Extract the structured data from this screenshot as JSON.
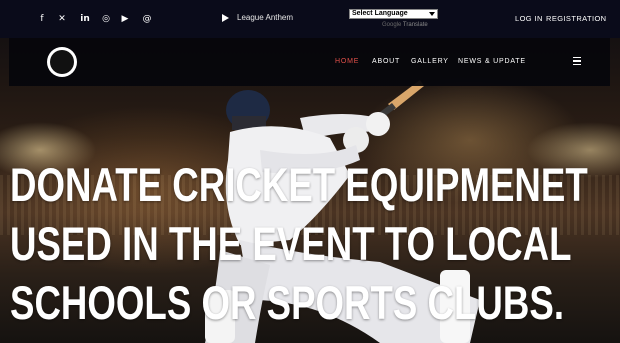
{
  "topbar": {
    "social": [
      {
        "name": "facebook-icon",
        "glyph": "f"
      },
      {
        "name": "x-icon",
        "glyph": "✕"
      },
      {
        "name": "linkedin-icon",
        "glyph": "in"
      },
      {
        "name": "instagram-icon",
        "glyph": "◎"
      },
      {
        "name": "youtube-icon",
        "glyph": "▶"
      },
      {
        "name": "threads-icon",
        "glyph": "@"
      }
    ],
    "anthem_label": "League Anthem",
    "language_select": "Select Language",
    "google_label": "Google",
    "translate_label": "Translate",
    "login_label": "LOG IN",
    "registration_label": "REGISTRATION"
  },
  "nav": {
    "items": [
      "HOME",
      "ABOUT",
      "GALLERY",
      "NEWS & UPDATE"
    ],
    "active_color": "#e2504a"
  },
  "hero": {
    "headline_lines": [
      "DONATE CRICKET EQUIPMENET",
      "USED IN THE EVENT TO LOCAL",
      "SCHOOLS OR SPORTS CLUBS."
    ]
  }
}
